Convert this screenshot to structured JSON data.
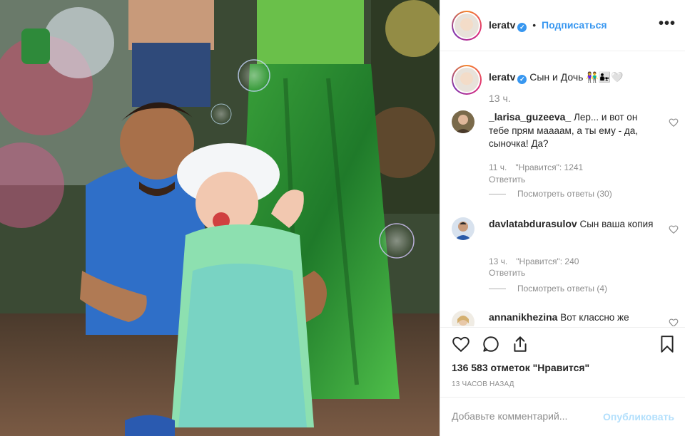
{
  "post": {
    "photo_alt": "",
    "username": "leratv",
    "verified_mark": "✓",
    "separator": "•",
    "follow_label": "Подписаться",
    "more_label": "•••"
  },
  "caption": {
    "username": "leratv",
    "text": "Сын и Дочь 👫👨‍👧🤍",
    "time": "13 ч."
  },
  "comments": [
    {
      "username": "_larisa_guzeeva_",
      "text": "Лер... и вот он тебе прям маааам, а ты ему - да, сыночка! Да?",
      "time": "11 ч.",
      "likes": "\"Нравится\": 1241",
      "reply": "Ответить",
      "view_replies": "Посмотреть ответы (30)"
    },
    {
      "username": "davlatabdurasulov",
      "text": "Сын ваша копия",
      "time": "13 ч.",
      "likes": "\"Нравится\": 240",
      "reply": "Ответить",
      "view_replies": "Посмотреть ответы (4)"
    },
    {
      "username": "annanikhezina",
      "text": "Вот классно же"
    }
  ],
  "actions": {
    "like_icon": "heart-icon",
    "comment_icon": "comment-icon",
    "share_icon": "share-icon",
    "save_icon": "bookmark-icon",
    "likes_count": "136 583 отметок \"Нравится\"",
    "posted_ago": "13 ЧАСОВ НАЗАД"
  },
  "add_comment": {
    "placeholder": "Добавьте комментарий...",
    "publish_label": "Опубликовать"
  },
  "colors": {
    "accent": "#3897f0",
    "publish_disabled": "#b2dffc",
    "muted": "#8e8e8e"
  }
}
